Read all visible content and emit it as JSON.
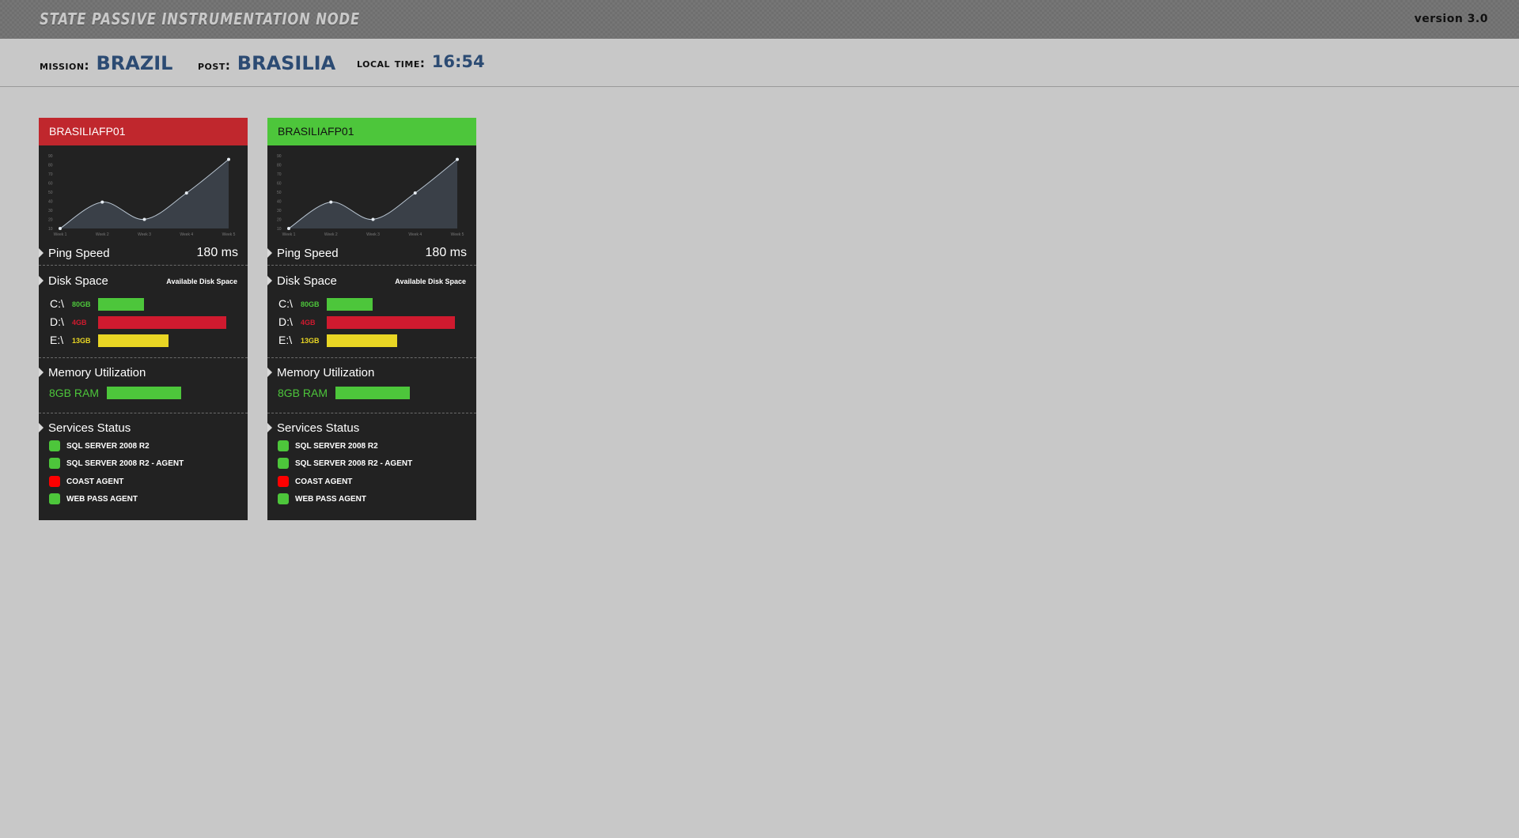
{
  "header": {
    "title": "STATE PASSIVE INSTRUMENTATION NODE",
    "version": "version 3.0"
  },
  "info": {
    "mission_label": "MISSION:",
    "mission_value": "BRAZIL",
    "post_label": "POST:",
    "post_value": "BRASILIA",
    "time_label": "LOCAL TIME:",
    "time_value": "16:54"
  },
  "colors": {
    "status_red": "#c0272d",
    "status_green": "#4dc63b",
    "bar_green": "#4dc63b",
    "bar_red": "#d01a2f",
    "bar_yellow": "#e9d624",
    "dot_red": "#ff0000",
    "value_blue": "#2c4b73"
  },
  "cards": [
    {
      "name": "BRASILIAFP01",
      "status": "red",
      "chart_data": {
        "type": "area",
        "x": [
          "Week 1",
          "Week 2",
          "Week 3",
          "Week 4",
          "Week 5"
        ],
        "values": [
          10,
          39,
          20,
          49,
          86
        ],
        "y_ticks": [
          "10",
          "20",
          "30",
          "40",
          "50",
          "60",
          "70",
          "80",
          "90"
        ],
        "ylim": [
          10,
          90
        ]
      },
      "ping": {
        "label": "Ping Speed",
        "value": "180 ms"
      },
      "disk": {
        "label": "Disk Space",
        "caption": "Available Disk Space",
        "drives": [
          {
            "drive": "C:\\",
            "size": "80GB",
            "color": "green",
            "fill": 0.36
          },
          {
            "drive": "D:\\",
            "size": "4GB",
            "color": "red",
            "fill": 1.0
          },
          {
            "drive": "E:\\",
            "size": "13GB",
            "color": "yellow",
            "fill": 0.55
          }
        ]
      },
      "memory": {
        "label": "Memory Utilization",
        "value": "8GB RAM",
        "fill": 1.0
      },
      "services": {
        "label": "Services Status",
        "items": [
          {
            "name": "SQL SERVER 2008 R2",
            "status": "green"
          },
          {
            "name": "SQL SERVER 2008 R2 - AGENT",
            "status": "green"
          },
          {
            "name": "COAST AGENT",
            "status": "red"
          },
          {
            "name": "WEB PASS AGENT",
            "status": "green"
          }
        ]
      }
    },
    {
      "name": "BRASILIAFP01",
      "status": "green",
      "chart_data": {
        "type": "area",
        "x": [
          "Week 1",
          "Week 2",
          "Week 3",
          "Week 4",
          "Week 5"
        ],
        "values": [
          10,
          39,
          20,
          49,
          86
        ],
        "y_ticks": [
          "10",
          "20",
          "30",
          "40",
          "50",
          "60",
          "70",
          "80",
          "90"
        ],
        "ylim": [
          10,
          90
        ]
      },
      "ping": {
        "label": "Ping Speed",
        "value": "180 ms"
      },
      "disk": {
        "label": "Disk Space",
        "caption": "Available Disk Space",
        "drives": [
          {
            "drive": "C:\\",
            "size": "80GB",
            "color": "green",
            "fill": 0.36
          },
          {
            "drive": "D:\\",
            "size": "4GB",
            "color": "red",
            "fill": 1.0
          },
          {
            "drive": "E:\\",
            "size": "13GB",
            "color": "yellow",
            "fill": 0.55
          }
        ]
      },
      "memory": {
        "label": "Memory Utilization",
        "value": "8GB RAM",
        "fill": 1.0
      },
      "services": {
        "label": "Services Status",
        "items": [
          {
            "name": "SQL SERVER 2008 R2",
            "status": "green"
          },
          {
            "name": "SQL SERVER 2008 R2 - AGENT",
            "status": "green"
          },
          {
            "name": "COAST AGENT",
            "status": "red"
          },
          {
            "name": "WEB PASS AGENT",
            "status": "green"
          }
        ]
      }
    }
  ]
}
